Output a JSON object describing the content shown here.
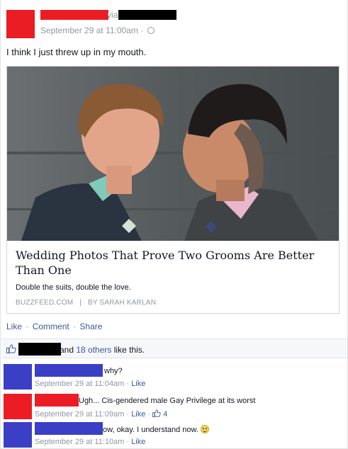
{
  "post": {
    "via_text": "via",
    "timestamp": "September 29 at 11:00am",
    "timestamp_separator": "·",
    "audience_icon": "globe-icon",
    "status": "I think I just threw up in my mouth.",
    "colors": {
      "redact_red": "#ec1c24",
      "redact_blue": "#3b3fc6",
      "redact_black": "#000000",
      "link": "#3b5998",
      "muted": "#9197a3"
    }
  },
  "link_card": {
    "title": "Wedding Photos That Prove Two Grooms Are Better Than One",
    "description": "Double the suits, double the love.",
    "source": "BUZZFEED.COM   |   BY SARAH KARLAN"
  },
  "actions": {
    "like": "Like",
    "comment": "Comment",
    "share": "Share",
    "separator": "·"
  },
  "likes": {
    "prefix": "and ",
    "others": "18 others",
    "suffix": " like this."
  },
  "comments": [
    {
      "text": "why?",
      "timestamp": "September 29 at 11:04am",
      "like_label": "Like"
    },
    {
      "text": "Ugh... Cis-gendered male Gay Privilege at its worst",
      "timestamp": "September 29 at 11:09am",
      "like_label": "Like",
      "like_count": "4"
    },
    {
      "text": "ow, okay. I understand now.",
      "timestamp": "September 29 at 11:10am",
      "like_label": "Like"
    }
  ]
}
